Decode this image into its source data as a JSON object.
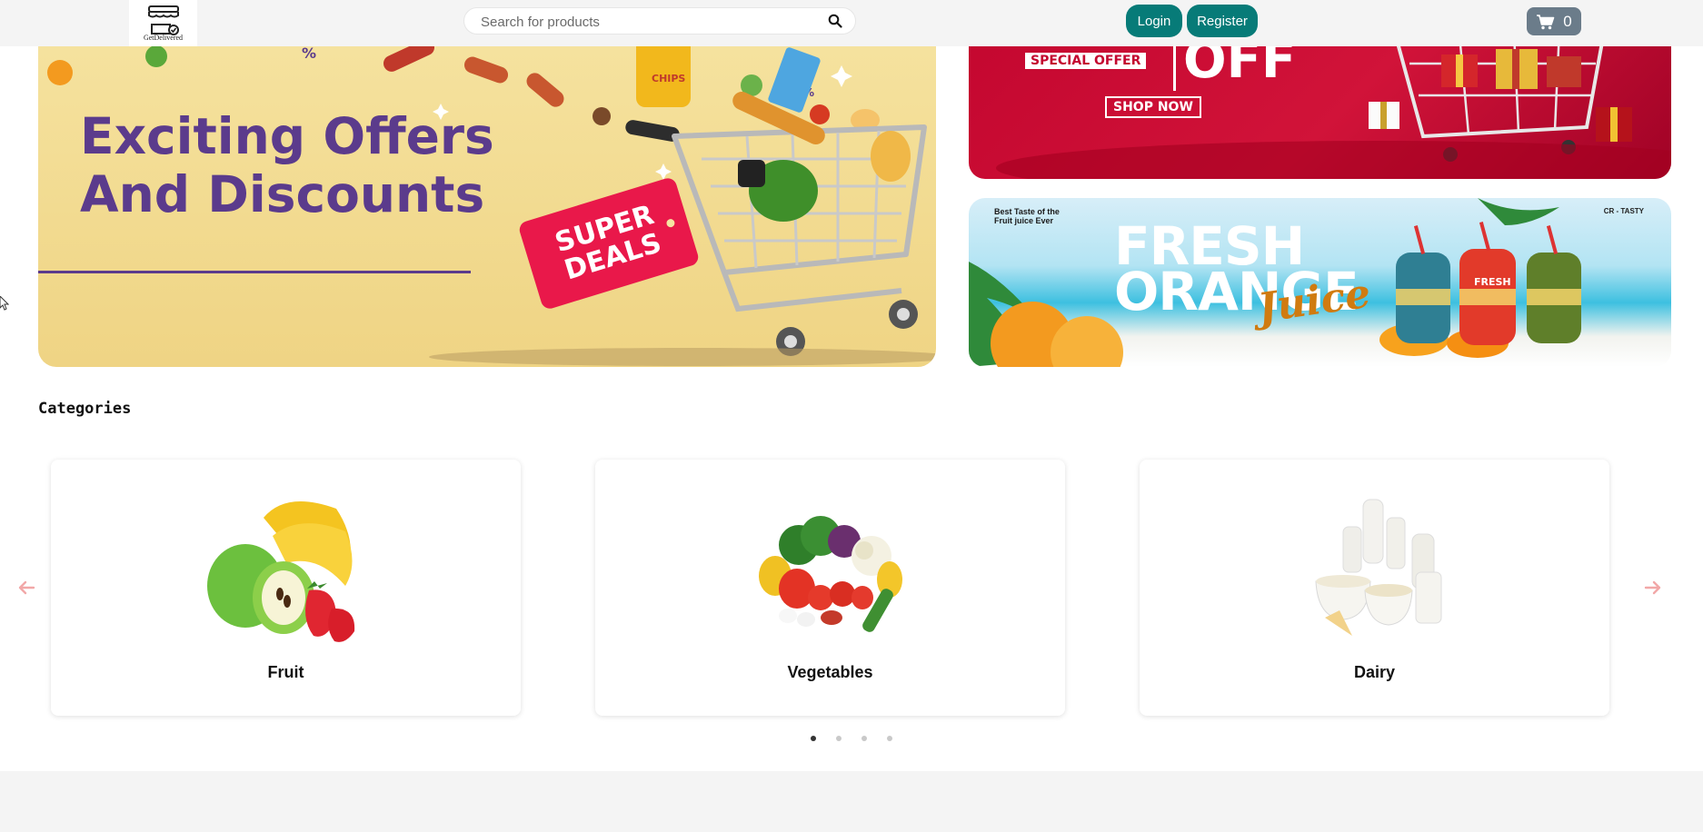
{
  "header": {
    "logo_text": "GetDelivered",
    "search": {
      "placeholder": "Search for products",
      "value": ""
    },
    "login_label": "Login",
    "register_label": "Register",
    "cart_count": "0",
    "accent_color": "#077b78"
  },
  "banners": {
    "main": {
      "headline_line1": "Exciting Offers",
      "headline_line2": "And Discounts",
      "tag_line1": "SUPER",
      "tag_line2": "DEALS",
      "chips_label": "CHIPS"
    },
    "sale": {
      "special_offer": "SPECIAL OFFER",
      "off_text": "OFF",
      "shop_now": "SHOP NOW"
    },
    "juice": {
      "tagline": "Best Taste of the Fruit juice Ever",
      "brand": "CR - TASTY",
      "fresh": "FRESH",
      "orange": "ORANGE",
      "script": "Juice",
      "bottle_label": "FRESH"
    }
  },
  "categories": {
    "title": "Categories",
    "items": [
      {
        "label": "Fruit",
        "icon": "fruit-image"
      },
      {
        "label": "Vegetables",
        "icon": "vegetables-image"
      },
      {
        "label": "Dairy",
        "icon": "dairy-image"
      }
    ],
    "page_count": 4,
    "active_page": 1
  },
  "icons": {
    "search": "search-icon",
    "cart": "cart-icon",
    "prev": "arrow-left-icon",
    "next": "arrow-right-icon"
  }
}
